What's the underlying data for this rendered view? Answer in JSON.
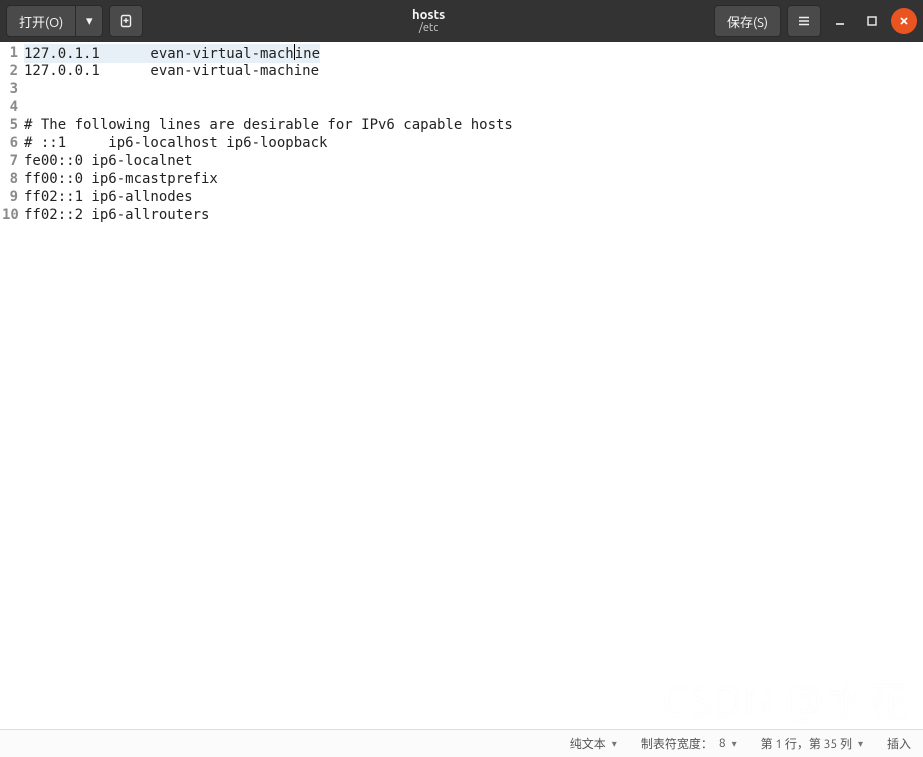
{
  "header": {
    "open_label": "打开(O)",
    "save_label": "保存(S)",
    "title": "hosts",
    "subtitle": "/etc"
  },
  "editor": {
    "lines": [
      "127.0.1.1      evan-virtual-machine",
      "127.0.0.1      evan-virtual-machine",
      "",
      "",
      "# The following lines are desirable for IPv6 capable hosts",
      "# ::1     ip6-localhost ip6-loopback",
      "fe00::0 ip6-localnet",
      "ff00::0 ip6-mcastprefix",
      "ff02::1 ip6-allnodes",
      "ff02::2 ip6-allrouters"
    ]
  },
  "status": {
    "syntax": "纯文本",
    "tabwidth_label": "制表符宽度：",
    "tabwidth_value": "8",
    "cursor_pos": "第 1 行，第 35 列",
    "mode": "插入"
  },
  "watermark": "CSDN @水花"
}
